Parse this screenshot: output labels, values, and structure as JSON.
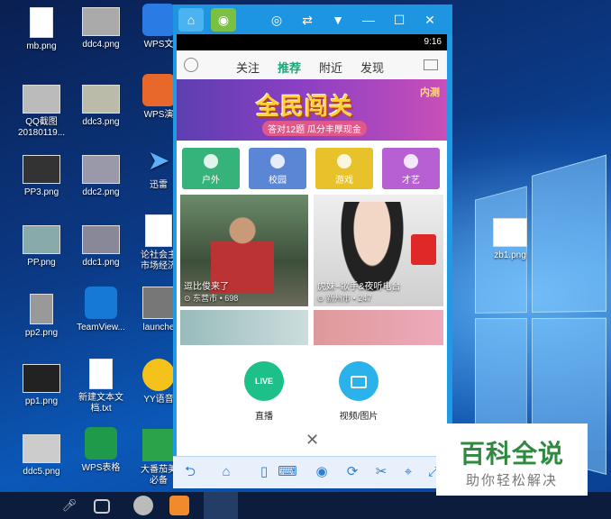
{
  "desktop": {
    "icons": [
      {
        "label": "mb.png"
      },
      {
        "label": "ddc4.png"
      },
      {
        "label": "WPS文"
      },
      {
        "label": "QQ截图\n20180119..."
      },
      {
        "label": "ddc3.png"
      },
      {
        "label": "WPS演"
      },
      {
        "label": "PP3.png"
      },
      {
        "label": "ddc2.png"
      },
      {
        "label": "迅雷"
      },
      {
        "label": "PP.png"
      },
      {
        "label": "ddc1.png"
      },
      {
        "label": "论社会主\n市场经济"
      },
      {
        "label": "pp2.png"
      },
      {
        "label": "TeamView..."
      },
      {
        "label": "launche"
      },
      {
        "label": "pp1.png"
      },
      {
        "label": "新建文本文\n档.txt"
      },
      {
        "label": "YY语音"
      },
      {
        "label": "ddc5.png"
      },
      {
        "label": "WPS表格"
      },
      {
        "label": "大番茄美\n必备"
      },
      {
        "label": "zb1.png"
      }
    ]
  },
  "emulator": {
    "phone": {
      "status_time": "9:16",
      "nav_tabs": [
        {
          "label": "关注",
          "active": false
        },
        {
          "label": "推荐",
          "active": true
        },
        {
          "label": "附近",
          "active": false
        },
        {
          "label": "发现",
          "active": false
        }
      ],
      "banner": {
        "title": "全民闯关",
        "subtitle": "答对12题 瓜分丰厚现金",
        "tag": "内测"
      },
      "categories": [
        {
          "label": "户外",
          "color": "#36b37a"
        },
        {
          "label": "校园",
          "color": "#5b86d6"
        },
        {
          "label": "游戏",
          "color": "#e7c22b"
        },
        {
          "label": "才艺",
          "color": "#b760d4"
        }
      ],
      "feed": [
        {
          "caption": "逗比俊来了",
          "location": "东营市",
          "viewers": "698"
        },
        {
          "caption": "虎妹~歌手&夜听电台",
          "location": "新州市",
          "viewers": "247"
        }
      ],
      "overlay": {
        "live_button": "LIVE",
        "live_label": "直播",
        "video_label": "视频/图片"
      }
    },
    "accent": "#1d95e0"
  },
  "watermark": {
    "title": "百科全说",
    "subtitle": "助你轻松解决"
  }
}
